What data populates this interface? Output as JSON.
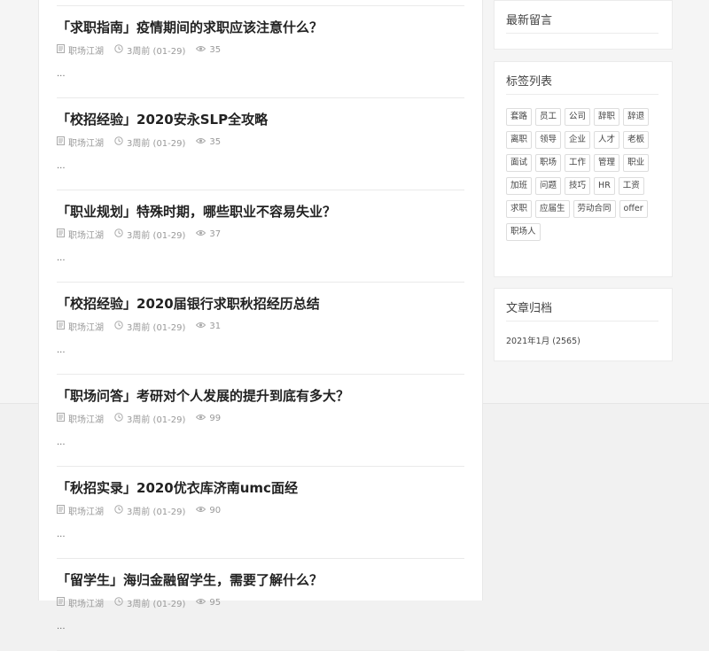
{
  "posts": [
    {
      "title": "「求职指南」疫情期间的求职应该注意什么？",
      "category": "职场江湖",
      "date": "3周前 (01-29)",
      "views": "35",
      "excerpt": "..."
    },
    {
      "title": "「校招经验」2020安永SLP全攻略",
      "category": "职场江湖",
      "date": "3周前 (01-29)",
      "views": "35",
      "excerpt": "..."
    },
    {
      "title": "「职业规划」特殊时期，哪些职业不容易失业？",
      "category": "职场江湖",
      "date": "3周前 (01-29)",
      "views": "37",
      "excerpt": "..."
    },
    {
      "title": "「校招经验」2020届银行求职秋招经历总结",
      "category": "职场江湖",
      "date": "3周前 (01-29)",
      "views": "31",
      "excerpt": "..."
    },
    {
      "title": "「职场问答」考研对个人发展的提升到底有多大？",
      "category": "职场江湖",
      "date": "3周前 (01-29)",
      "views": "99",
      "excerpt": "..."
    },
    {
      "title": "「秋招实录」2020优衣库济南umc面经",
      "category": "职场江湖",
      "date": "3周前 (01-29)",
      "views": "90",
      "excerpt": "..."
    },
    {
      "title": "「留学生」海归金融留学生，需要了解什么？",
      "category": "职场江湖",
      "date": "3周前 (01-29)",
      "views": "95",
      "excerpt": "..."
    }
  ],
  "sidebar": {
    "recent_comments": {
      "title": "最新留言"
    },
    "tags": {
      "title": "标签列表",
      "items": [
        "套路",
        "员工",
        "公司",
        "辞职",
        "辞退",
        "离职",
        "领导",
        "企业",
        "人才",
        "老板",
        "面试",
        "职场",
        "工作",
        "管理",
        "职业",
        "加班",
        "问题",
        "技巧",
        "HR",
        "工资",
        "求职",
        "应届生",
        "劳动合同",
        "offer",
        "职场人"
      ]
    },
    "archive": {
      "title": "文章归档",
      "items": [
        "2021年1月 (2565)"
      ]
    }
  }
}
